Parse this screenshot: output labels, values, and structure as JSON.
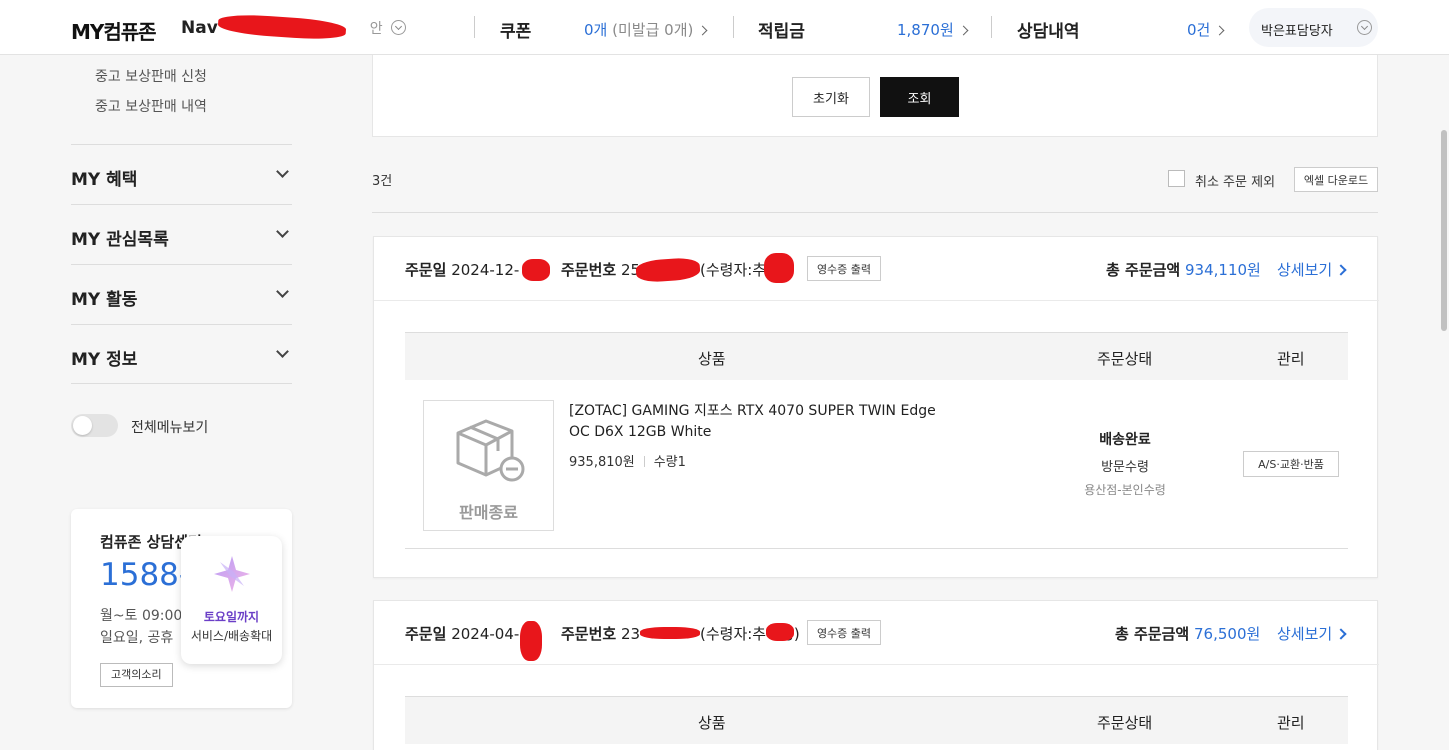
{
  "header": {
    "brand": "MY컴퓨존",
    "username_visible": "Nav",
    "username_suffix": "안",
    "coupon": {
      "label": "쿠폰",
      "value": "0개",
      "sub": "(미발급 0개)"
    },
    "points": {
      "label": "적립금",
      "value": "1,870원"
    },
    "consult": {
      "label": "상담내역",
      "value": "0건"
    },
    "manager": "박은표담당자"
  },
  "sidebar": {
    "links": [
      "중고 보상판매 신청",
      "중고 보상판매 내역"
    ],
    "sections": [
      "MY 혜택",
      "MY 관심목록",
      "MY 활동",
      "MY 정보"
    ],
    "toggle_label": "전체메뉴보기",
    "support": {
      "title": "컴퓨존 상담센터",
      "phone": "1588-",
      "hours1": "월~토 09:00",
      "hours2": "일요일, 공휴",
      "button": "고객의소리"
    },
    "promo": {
      "line1": "토요일까지",
      "line2": "서비스/배송확대"
    }
  },
  "search": {
    "reset": "초기화",
    "submit": "조회"
  },
  "results": {
    "count": "3건",
    "exclude_cancelled": "취소 주문 제외",
    "excel": "엑셀 다운로드"
  },
  "orders": [
    {
      "date_label": "주문일",
      "date": "2024-12-",
      "no_label": "주문번호",
      "no": "25",
      "receiver": "(수령자:추",
      "receiver_end": ")",
      "receipt": "영수증 출력",
      "total_label": "총 주문금액",
      "total": "934,110원",
      "detail": "상세보기",
      "columns": {
        "product": "상품",
        "status": "주문상태",
        "manage": "관리"
      },
      "item": {
        "thumb_label": "판매종료",
        "name": "[ZOTAC] GAMING 지포스 RTX 4070 SUPER TWIN Edge OC D6X 12GB White",
        "price": "935,810원",
        "qty": "수량1",
        "status": "배송완료",
        "method": "방문수령",
        "store": "용산점-본인수령",
        "action": "A/S·교환·반품"
      }
    },
    {
      "date_label": "주문일",
      "date": "2024-04-",
      "no_label": "주문번호",
      "no": "23",
      "receiver": "(수령자:추",
      "receiver_end": "령)",
      "receipt": "영수증 출력",
      "total_label": "총 주문금액",
      "total": "76,500원",
      "detail": "상세보기",
      "columns": {
        "product": "상품",
        "status": "주문상태",
        "manage": "관리"
      }
    }
  ]
}
